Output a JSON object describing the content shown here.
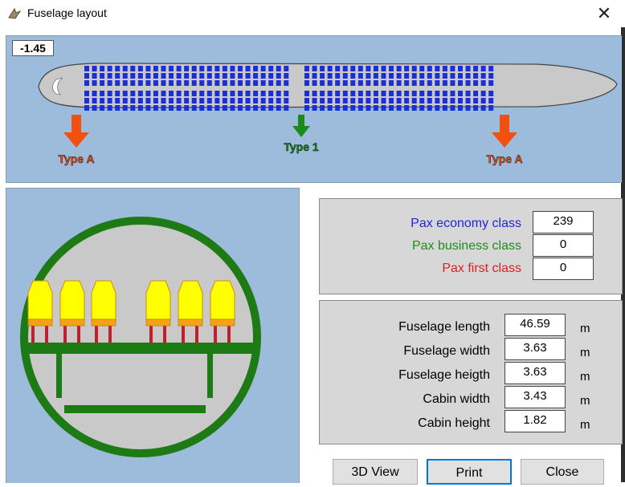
{
  "window": {
    "title": "Fuselage layout",
    "close_glyph": "✕"
  },
  "top_view": {
    "offset_value": "-1.45",
    "doors": [
      {
        "label": "Type A",
        "color": "#f25010"
      },
      {
        "label": "Type 1",
        "color": "#1a8a1a"
      },
      {
        "label": "Type A",
        "color": "#f25010"
      }
    ]
  },
  "pax": [
    {
      "label": "Pax economy class",
      "value": "239",
      "color": "#2323d8"
    },
    {
      "label": "Pax business class",
      "value": "0",
      "color": "#1e8c1e"
    },
    {
      "label": "Pax first class",
      "value": "0",
      "color": "#e02020"
    }
  ],
  "dimensions": [
    {
      "label": "Fuselage length",
      "value": "46.59",
      "unit": "m"
    },
    {
      "label": "Fuselage width",
      "value": "3.63",
      "unit": "m"
    },
    {
      "label": "Fuselage heigth",
      "value": "3.63",
      "unit": "m"
    },
    {
      "label": "Cabin width",
      "value": "3.43",
      "unit": "m"
    },
    {
      "label": "Cabin height",
      "value": "1.82",
      "unit": "m"
    }
  ],
  "buttons": {
    "view3d": "3D View",
    "print": "Print",
    "close": "Close"
  },
  "colors": {
    "panel_bg": "#9dbcdc",
    "seat_blue": "#1c2fd6",
    "hull_green": "#1e7a14",
    "seat_yellow": "#ffff00"
  }
}
